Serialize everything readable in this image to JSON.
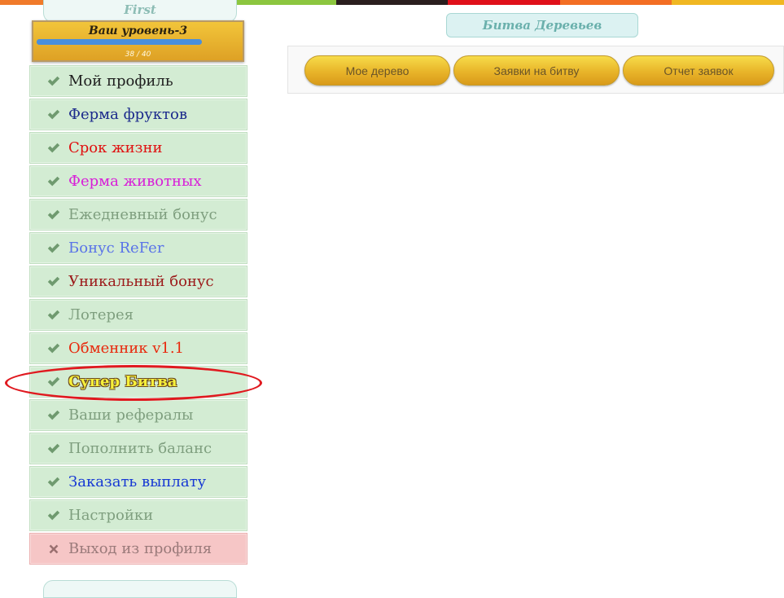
{
  "top_strip_colors": [
    "#f07a2a",
    "#f0a126",
    "#8cc63f",
    "#2a1e1e",
    "#e0101a",
    "#f36e24",
    "#f0b722"
  ],
  "user_tab": {
    "name": "First"
  },
  "level": {
    "title": "Ваш уровень-3",
    "count_text": "38 / 40",
    "progress": 0.95,
    "bar_color": "#4a8fdb"
  },
  "menu": [
    {
      "label": "Мой профиль",
      "color": "#1e1e1e",
      "icon": "check-icon"
    },
    {
      "label": "Ферма фруктов",
      "color": "#1b2a8c",
      "icon": "check-icon"
    },
    {
      "label": "Срок жизни",
      "color": "#e01010",
      "icon": "check-icon"
    },
    {
      "label": "Ферма животных",
      "color": "#d81ed8",
      "icon": "check-icon"
    },
    {
      "label": "Ежедневный бонус",
      "color": "#7f9f7f",
      "icon": "check-icon"
    },
    {
      "label": "Бонус ReFer",
      "color": "#5a74e8",
      "icon": "check-icon"
    },
    {
      "label": "Уникальный бонус",
      "color": "#9c1a1a",
      "icon": "check-icon"
    },
    {
      "label": "Лотерея",
      "color": "#7f9f7f",
      "icon": "check-icon"
    },
    {
      "label": "Обменник v1.1",
      "color": "#e8280c",
      "icon": "check-icon"
    },
    {
      "label": "Супер Битва",
      "color": "#f7f03a",
      "icon": "check-icon",
      "highlight": true
    },
    {
      "label": "Ваши рефералы",
      "color": "#7f9f7f",
      "icon": "check-icon"
    },
    {
      "label": "Пополнить баланс",
      "color": "#7f9f7f",
      "icon": "check-icon"
    },
    {
      "label": "Заказать выплату",
      "color": "#1638d4",
      "icon": "check-icon"
    },
    {
      "label": "Настройки",
      "color": "#7f9f7f",
      "icon": "check-icon"
    },
    {
      "label": "Выход из профиля",
      "color": "#9a7a7a",
      "icon": "close-icon",
      "danger": true
    }
  ],
  "main": {
    "title": "Битва Деревьев",
    "buttons": [
      {
        "label": "Мое дерево"
      },
      {
        "label": "Заявки на битву"
      },
      {
        "label": "Отчет заявок"
      }
    ]
  }
}
